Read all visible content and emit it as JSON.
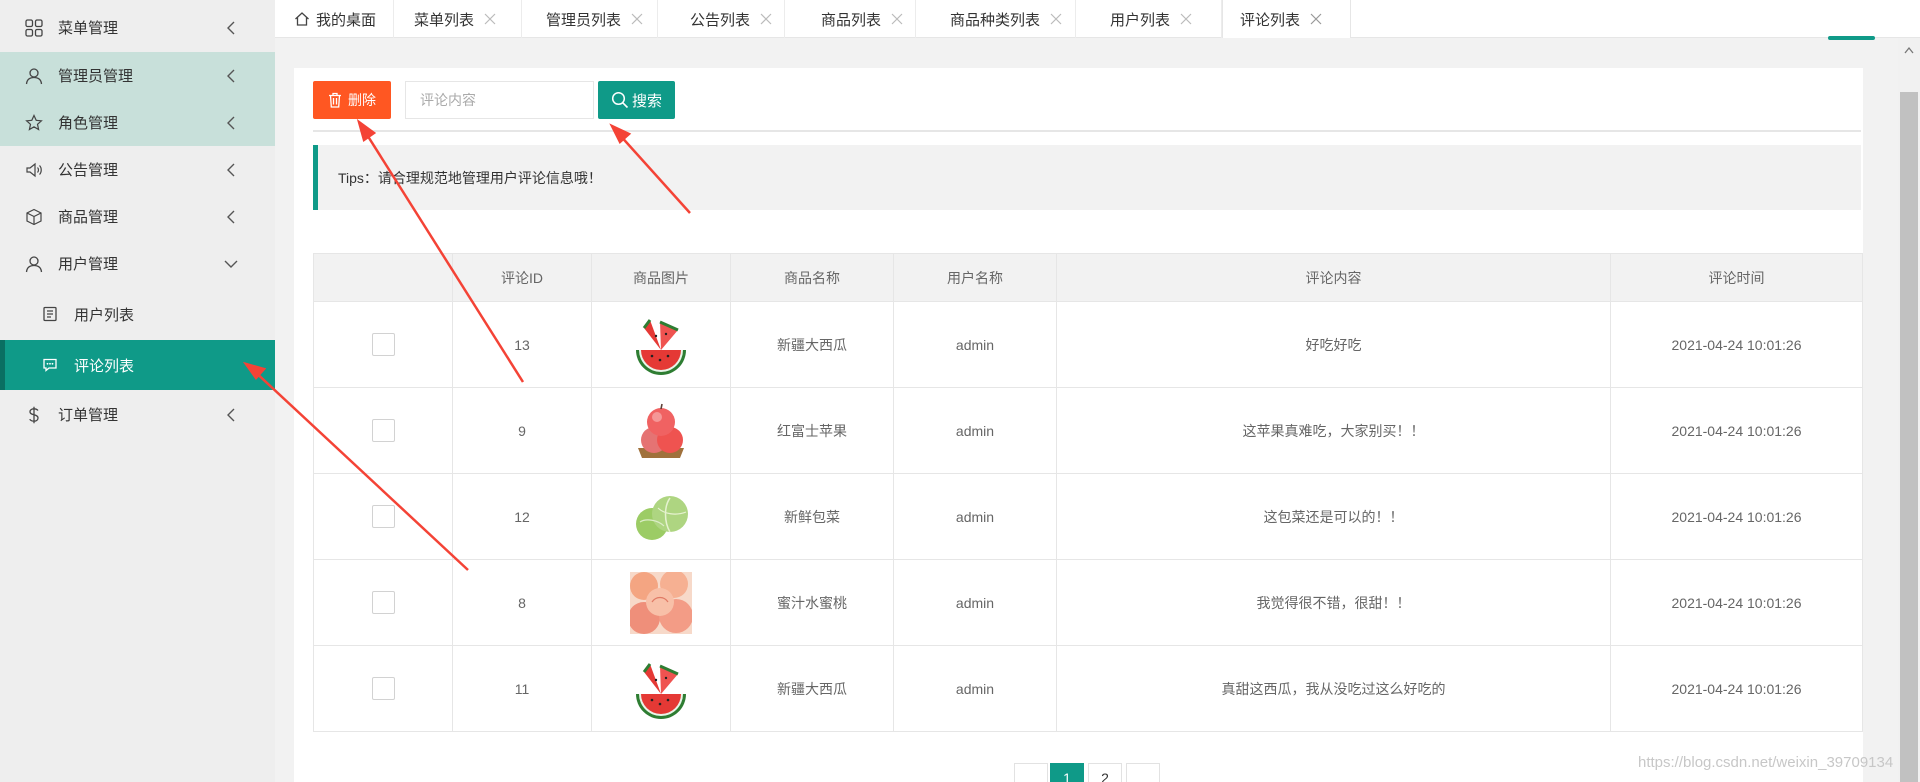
{
  "sidebar": {
    "items": [
      {
        "label": "菜单管理",
        "icon": "grid-icon"
      },
      {
        "label": "管理员管理",
        "icon": "user-icon"
      },
      {
        "label": "角色管理",
        "icon": "star-icon"
      },
      {
        "label": "公告管理",
        "icon": "speaker-icon"
      },
      {
        "label": "商品管理",
        "icon": "box-icon"
      },
      {
        "label": "用户管理",
        "icon": "user-icon"
      },
      {
        "label": "用户列表",
        "icon": "doc-icon"
      },
      {
        "label": "评论列表",
        "icon": "comment-icon"
      },
      {
        "label": "订单管理",
        "icon": "dollar-icon"
      }
    ]
  },
  "tabs": [
    {
      "label": "我的桌面"
    },
    {
      "label": "菜单列表"
    },
    {
      "label": "管理员列表"
    },
    {
      "label": "公告列表"
    },
    {
      "label": "商品列表"
    },
    {
      "label": "商品种类列表"
    },
    {
      "label": "用户列表"
    },
    {
      "label": "评论列表"
    }
  ],
  "toolbar": {
    "delete_label": "删除",
    "search_placeholder": "评论内容",
    "search_label": "搜索"
  },
  "tips": "Tips：请合理规范地管理用户评论信息哦！",
  "table": {
    "headers": [
      "",
      "评论ID",
      "商品图片",
      "商品名称",
      "用户名称",
      "评论内容",
      "评论时间"
    ],
    "rows": [
      {
        "id": "13",
        "image": "watermelon",
        "product": "新疆大西瓜",
        "user": "admin",
        "content": "好吃好吃",
        "time": "2021-04-24 10:01:26"
      },
      {
        "id": "9",
        "image": "apple",
        "product": "红富士苹果",
        "user": "admin",
        "content": "这苹果真难吃，大家别买！！",
        "time": "2021-04-24 10:01:26"
      },
      {
        "id": "12",
        "image": "cabbage",
        "product": "新鲜包菜",
        "user": "admin",
        "content": "这包菜还是可以的！！",
        "time": "2021-04-24 10:01:26"
      },
      {
        "id": "8",
        "image": "peach",
        "product": "蜜汁水蜜桃",
        "user": "admin",
        "content": "我觉得很不错，很甜！！",
        "time": "2021-04-24 10:01:26"
      },
      {
        "id": "11",
        "image": "watermelon",
        "product": "新疆大西瓜",
        "user": "admin",
        "content": "真甜这西瓜，我从没吃过这么好吃的",
        "time": "2021-04-24 10:01:26"
      }
    ]
  },
  "pagination": {
    "current": "1",
    "next": "2"
  },
  "watermark": "https://blog.csdn.net/weixin_39709134",
  "colors": {
    "primary": "#0f9a88",
    "danger": "#ff5722",
    "annotation": "#f44336"
  }
}
